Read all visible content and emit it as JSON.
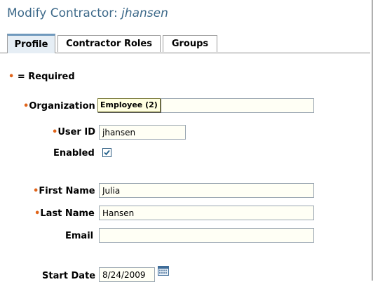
{
  "header": {
    "title_prefix": "Modify Contractor: ",
    "username": "jhansen"
  },
  "tabs": [
    {
      "label": "Profile",
      "active": true
    },
    {
      "label": "Contractor Roles",
      "active": false
    },
    {
      "label": "Groups",
      "active": false
    }
  ],
  "required_note": {
    "marker": "•",
    "text": " = Required"
  },
  "form": {
    "organization": {
      "label": "Organization",
      "required": true,
      "value": "",
      "tooltip": "Employee (2)"
    },
    "user_id": {
      "label": "User ID",
      "required": true,
      "value": "jhansen"
    },
    "enabled": {
      "label": "Enabled",
      "checked": true
    },
    "first_name": {
      "label": "First Name",
      "required": true,
      "value": "Julia"
    },
    "last_name": {
      "label": "Last Name",
      "required": true,
      "value": "Hansen"
    },
    "email": {
      "label": "Email",
      "required": false,
      "value": ""
    },
    "start_date": {
      "label": "Start Date",
      "required": false,
      "value": "8/24/2009"
    }
  },
  "icons": {
    "calendar": "calendar-icon",
    "check": "checkmark-icon"
  },
  "colors": {
    "title": "#3e6a8a",
    "required_dot": "#e0641a",
    "tab_accent": "#6f99bd"
  }
}
